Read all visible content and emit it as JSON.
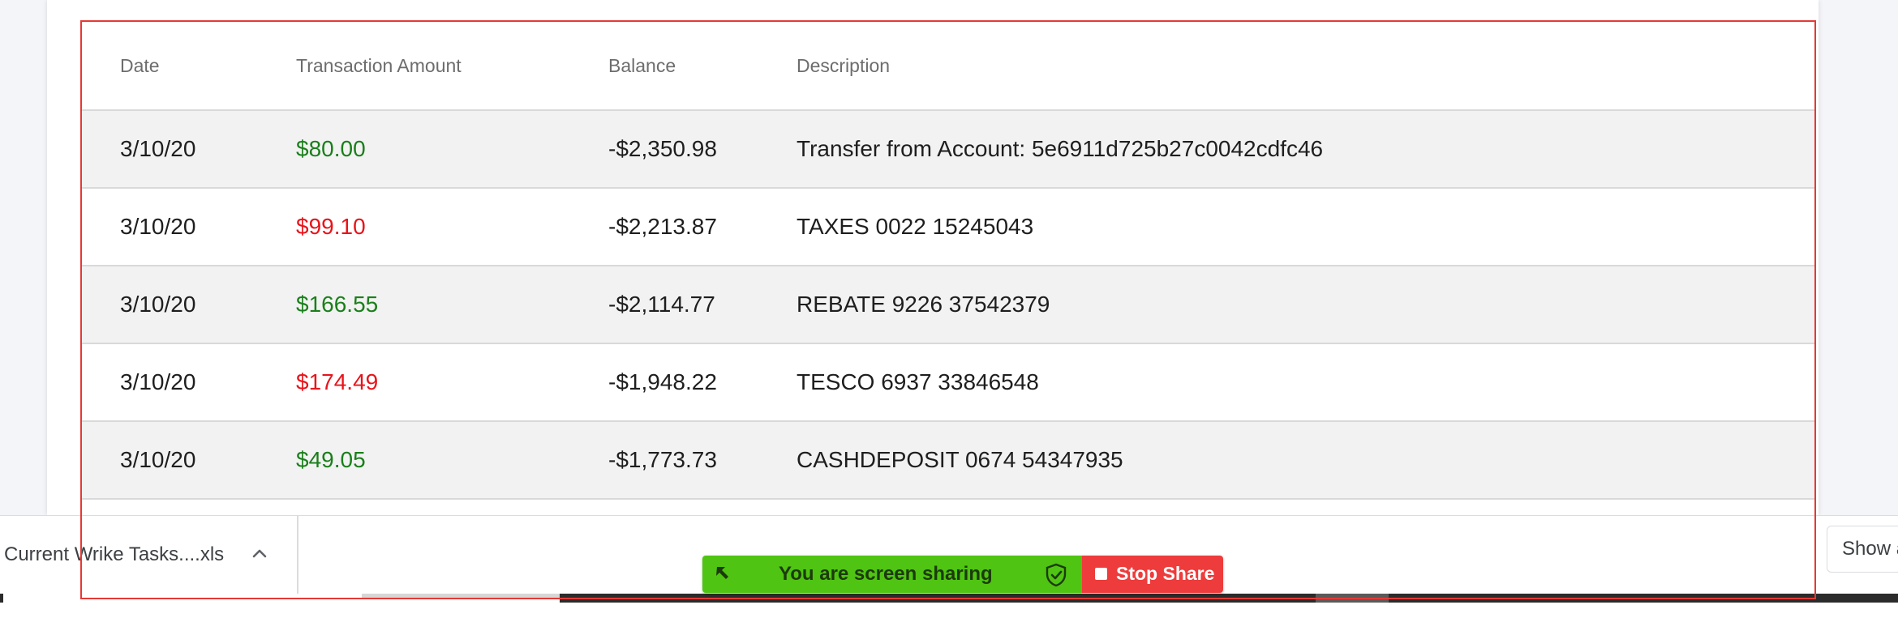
{
  "table": {
    "headers": {
      "date": "Date",
      "amount": "Transaction Amount",
      "balance": "Balance",
      "description": "Description"
    },
    "rows": [
      {
        "date": "3/10/20",
        "amount": "$80.00",
        "type": "credit",
        "balance": "-$2,350.98",
        "description": "Transfer from Account: 5e6911d725b27c0042cdfc46"
      },
      {
        "date": "3/10/20",
        "amount": "$99.10",
        "type": "debit",
        "balance": "-$2,213.87",
        "description": "TAXES 0022 15245043"
      },
      {
        "date": "3/10/20",
        "amount": "$166.55",
        "type": "credit",
        "balance": "-$2,114.77",
        "description": "REBATE 9226 37542379"
      },
      {
        "date": "3/10/20",
        "amount": "$174.49",
        "type": "debit",
        "balance": "-$1,948.22",
        "description": "TESCO 6937 33846548"
      },
      {
        "date": "3/10/20",
        "amount": "$49.05",
        "type": "credit",
        "balance": "-$1,773.73",
        "description": "CASHDEPOSIT 0674 54347935"
      }
    ]
  },
  "download_bar": {
    "file_name": "Current Wrike Tasks....xls",
    "chevron_icon": "chevron-up-icon",
    "show_all_label": "Show a"
  },
  "share_bar": {
    "status_text": "You are screen sharing",
    "stop_label": "Stop Share",
    "arrow_icon": "share-arrow-icon",
    "shield_icon": "shield-check-icon",
    "stop_icon": "stop-square-icon"
  },
  "colors": {
    "credit": "#1a7f1a",
    "debit": "#e8141a",
    "highlight": "#e53935",
    "share_green": "#4fc412",
    "stop_red": "#ee3b3b"
  }
}
